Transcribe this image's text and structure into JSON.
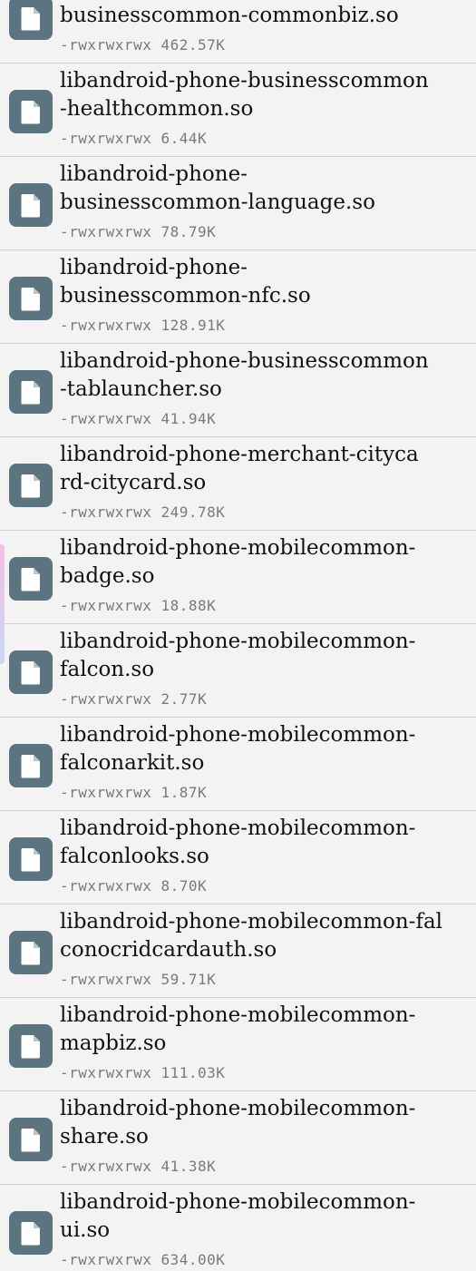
{
  "files": [
    {
      "name": "libandroid-phone-\nbusinesscommon-commonbiz.so",
      "perms": "-rwxrwxrwx",
      "size": "462.57K"
    },
    {
      "name": "libandroid-phone-businesscommon\n-healthcommon.so",
      "perms": "-rwxrwxrwx",
      "size": "6.44K"
    },
    {
      "name": "libandroid-phone-\nbusinesscommon-language.so",
      "perms": "-rwxrwxrwx",
      "size": "78.79K"
    },
    {
      "name": "libandroid-phone-\nbusinesscommon-nfc.so",
      "perms": "-rwxrwxrwx",
      "size": "128.91K"
    },
    {
      "name": "libandroid-phone-businesscommon\n-tablauncher.so",
      "perms": "-rwxrwxrwx",
      "size": "41.94K"
    },
    {
      "name": "libandroid-phone-merchant-cityca\nrd-citycard.so",
      "perms": "-rwxrwxrwx",
      "size": "249.78K"
    },
    {
      "name": "libandroid-phone-mobilecommon-\nbadge.so",
      "perms": "-rwxrwxrwx",
      "size": "18.88K"
    },
    {
      "name": "libandroid-phone-mobilecommon-\nfalcon.so",
      "perms": "-rwxrwxrwx",
      "size": "2.77K"
    },
    {
      "name": "libandroid-phone-mobilecommon-\nfalconarkit.so",
      "perms": "-rwxrwxrwx",
      "size": "1.87K"
    },
    {
      "name": "libandroid-phone-mobilecommon-\nfalconlooks.so",
      "perms": "-rwxrwxrwx",
      "size": "8.70K"
    },
    {
      "name": "libandroid-phone-mobilecommon-fal\nconocridcardauth.so",
      "perms": "-rwxrwxrwx",
      "size": "59.71K"
    },
    {
      "name": "libandroid-phone-mobilecommon-\nmapbiz.so",
      "perms": "-rwxrwxrwx",
      "size": "111.03K"
    },
    {
      "name": "libandroid-phone-mobilecommon-\nshare.so",
      "perms": "-rwxrwxrwx",
      "size": "41.38K"
    },
    {
      "name": "libandroid-phone-mobilecommon-\nui.so",
      "perms": "-rwxrwxrwx",
      "size": "634.00K"
    }
  ],
  "icon": "file-icon"
}
